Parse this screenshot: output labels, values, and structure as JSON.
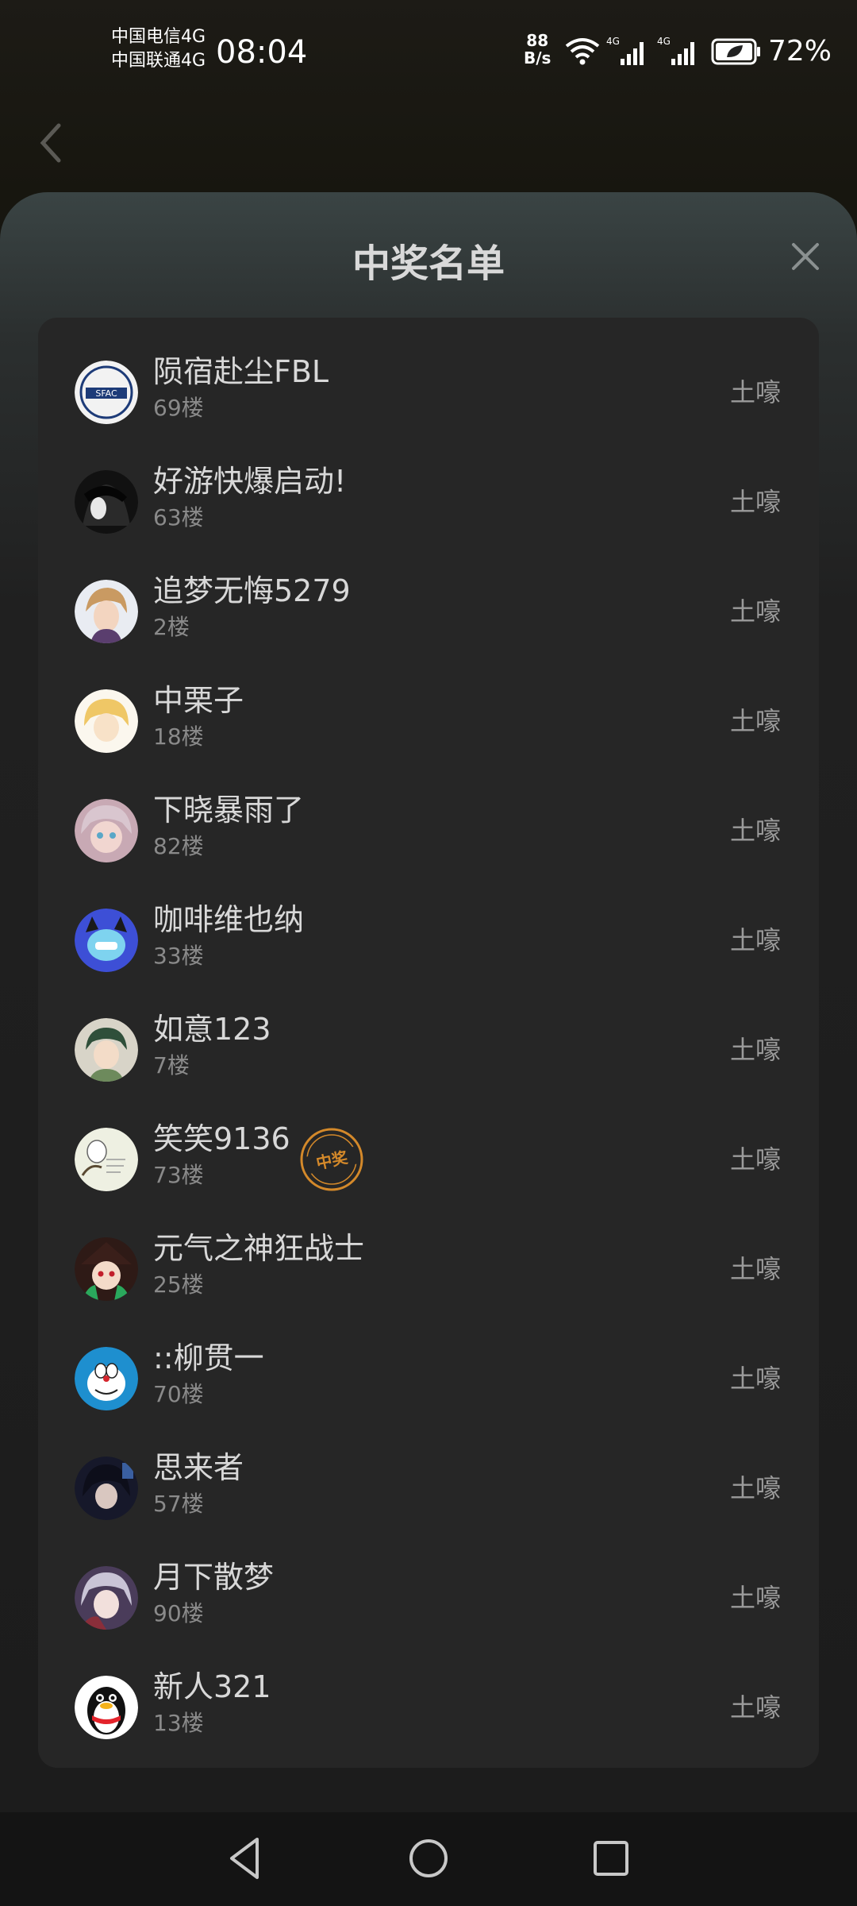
{
  "status_bar": {
    "carrier_1": "中国电信4G",
    "carrier_2": "中国联通4G",
    "time": "08:04",
    "net_speed_value": "88",
    "net_speed_unit": "B/s",
    "signal_1_label": "4G",
    "signal_2_label": "4G",
    "battery_percent": "72%"
  },
  "dialog": {
    "title": "中奖名单"
  },
  "winners": [
    {
      "name": "陨宿赴尘FBL",
      "floor": "69楼",
      "prize": "土嚎",
      "avatar": "sfac-logo-avatar"
    },
    {
      "name": "好游快爆启动!",
      "floor": "63楼",
      "prize": "土嚎",
      "avatar": "dark-anime-avatar"
    },
    {
      "name": "追梦无悔5279",
      "floor": "2楼",
      "prize": "土嚎",
      "avatar": "anime-boy-avatar"
    },
    {
      "name": "中栗子",
      "floor": "18楼",
      "prize": "土嚎",
      "avatar": "blonde-anime-avatar"
    },
    {
      "name": "下晓暴雨了",
      "floor": "82楼",
      "prize": "土嚎",
      "avatar": "pink-anime-avatar"
    },
    {
      "name": "咖啡维也纳",
      "floor": "33楼",
      "prize": "土嚎",
      "avatar": "blue-cat-avatar"
    },
    {
      "name": "如意123",
      "floor": "7楼",
      "prize": "土嚎",
      "avatar": "green-hair-avatar"
    },
    {
      "name": "笑笑9136",
      "floor": "73楼",
      "prize": "土嚎",
      "avatar": "sketch-avatar",
      "badge": "中奖"
    },
    {
      "name": "元气之神狂战士",
      "floor": "25楼",
      "prize": "土嚎",
      "avatar": "red-hat-avatar"
    },
    {
      "name": "::柳贯一",
      "floor": "70楼",
      "prize": "土嚎",
      "avatar": "doraemon-avatar"
    },
    {
      "name": "思来者",
      "floor": "57楼",
      "prize": "土嚎",
      "avatar": "dark-hair-avatar"
    },
    {
      "name": "月下散梦",
      "floor": "90楼",
      "prize": "土嚎",
      "avatar": "silver-hair-avatar"
    },
    {
      "name": "新人321",
      "floor": "13楼",
      "prize": "土嚎",
      "avatar": "penguin-avatar"
    }
  ],
  "colors": {
    "badge": "#d4892a",
    "card": "#262626",
    "prize_text": "#9b9b9b"
  }
}
